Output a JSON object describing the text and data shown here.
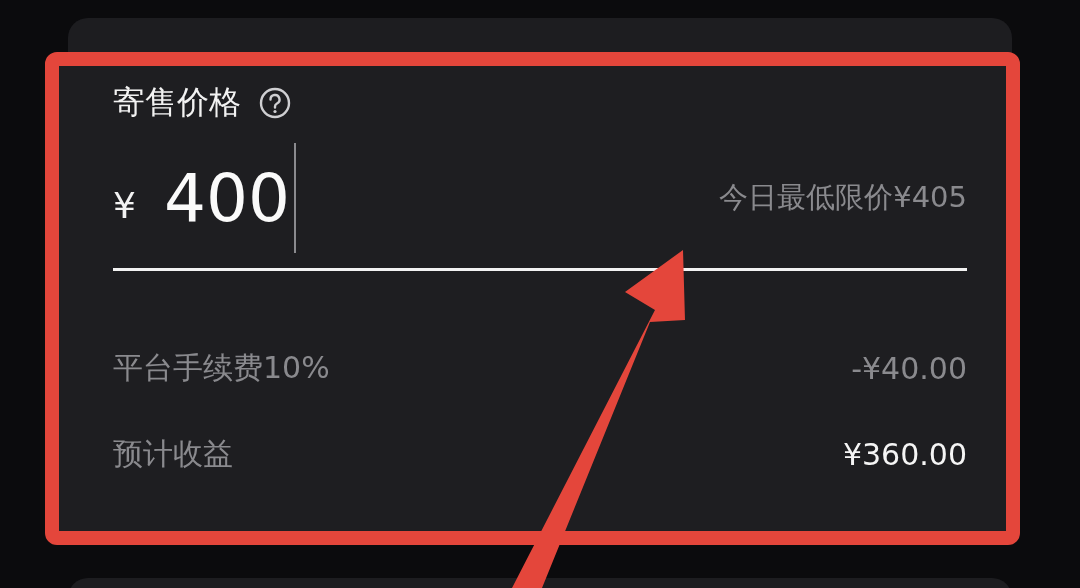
{
  "price_section": {
    "title": "寄售价格",
    "price": {
      "currency": "¥",
      "value": "400",
      "focused": true
    },
    "min_price_note": "今日最低限价¥405",
    "summary_rows": [
      {
        "label": "平台手续费10%",
        "amount": "-¥40.00",
        "emphasized": false
      },
      {
        "label": "预计收益",
        "amount": "¥360.00",
        "emphasized": true
      }
    ]
  }
}
